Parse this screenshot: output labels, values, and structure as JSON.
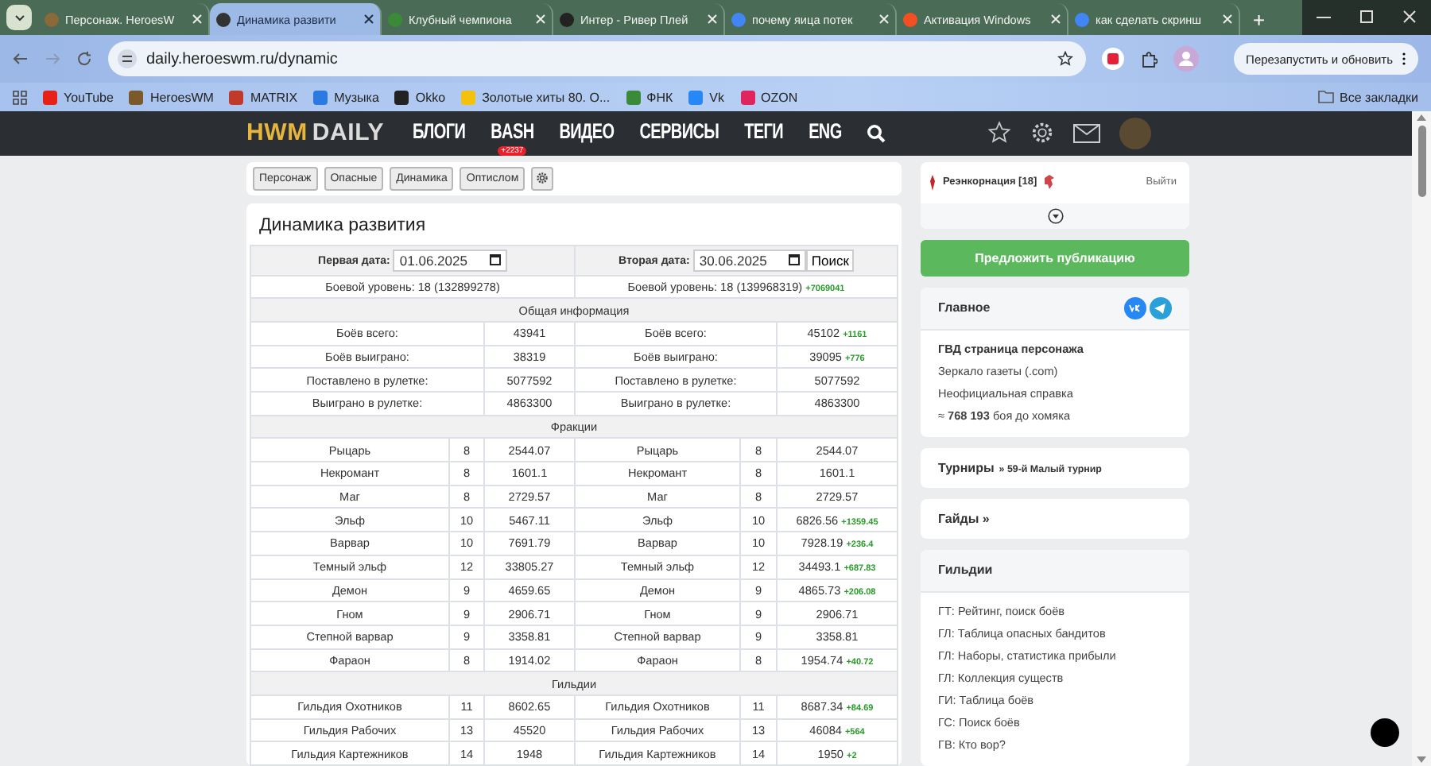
{
  "browser": {
    "tabs": [
      {
        "title": "Персонаж. HeroesW",
        "selected": false,
        "color": "#8a6a3a"
      },
      {
        "title": "Динамика развити",
        "selected": true,
        "color": "#333333"
      },
      {
        "title": "Клубный чемпиона",
        "selected": false,
        "color": "#3a8a3a"
      },
      {
        "title": "Интер - Ривер Плей",
        "selected": false,
        "color": "#222222"
      },
      {
        "title": "почему яица потек",
        "selected": false,
        "color": "#4285f4"
      },
      {
        "title": "Активация Windows",
        "selected": false,
        "color": "#f25022"
      },
      {
        "title": "как сделать скринш",
        "selected": false,
        "color": "#4285f4"
      }
    ],
    "new_tab": "+",
    "address": "daily.heroeswm.ru/dynamic",
    "restart_button": "Перезапустить и обновить",
    "bookmarks": [
      {
        "label": "YouTube",
        "color": "#e62117"
      },
      {
        "label": "HeroesWM",
        "color": "#7a5a2a"
      },
      {
        "label": "MATRIX",
        "color": "#c0392b"
      },
      {
        "label": "Музыка",
        "color": "#2a7ae2"
      },
      {
        "label": "Okko",
        "color": "#222222"
      },
      {
        "label": "Золотые хиты 80. О...",
        "color": "#f4c20d"
      },
      {
        "label": "ФНК",
        "color": "#3a8a3a"
      },
      {
        "label": "Vk",
        "color": "#2787f5"
      },
      {
        "label": "OZON",
        "color": "#e0245e"
      }
    ],
    "all_bookmarks": "Все закладки"
  },
  "site_nav": {
    "logo_first": "HWM",
    "logo_second": "DAILY",
    "menu": [
      {
        "label": "БЛОГИ"
      },
      {
        "label": "BASH",
        "badge": "+2237"
      },
      {
        "label": "ВИДЕО"
      },
      {
        "label": "СЕРВИСЫ"
      },
      {
        "label": "ТЕГИ"
      },
      {
        "label": "ENG"
      }
    ]
  },
  "subnav": [
    "Персонаж",
    "Опасные",
    "Динамика",
    "Оптислом"
  ],
  "dynamics": {
    "title": "Динамика развития",
    "first_date": {
      "label": "Первая дата:",
      "value": "01.06.2025"
    },
    "second_date": {
      "label": "Вторая дата:",
      "value": "30.06.2025"
    },
    "search_button": "Поиск",
    "level": {
      "left": "Боевой уровень: 18 (132899278)",
      "right": "Боевой уровень: 18 (139968319)",
      "right_delta": "+7069041"
    },
    "sections": [
      {
        "title": "Общая информация",
        "kind": "stats",
        "rows": [
          {
            "left_name": "Боёв всего:",
            "left_value": "43941",
            "right_name": "Боёв всего:",
            "right_value": "45102",
            "delta": "+1161"
          },
          {
            "left_name": "Боёв выиграно:",
            "left_value": "38319",
            "right_name": "Боёв выиграно:",
            "right_value": "39095",
            "delta": "+776"
          },
          {
            "left_name": "Поставлено в рулетке:",
            "left_value": "5077592",
            "right_name": "Поставлено в рулетке:",
            "right_value": "5077592"
          },
          {
            "left_name": "Выиграно в рулетке:",
            "left_value": "4863300",
            "right_name": "Выиграно в рулетке:",
            "right_value": "4863300"
          }
        ]
      },
      {
        "title": "Фракции",
        "kind": "levels",
        "rows": [
          {
            "left_name": "Рыцарь",
            "left_level": "8",
            "left_value": "2544.07",
            "right_name": "Рыцарь",
            "right_level": "8",
            "right_value": "2544.07"
          },
          {
            "left_name": "Некромант",
            "left_level": "8",
            "left_value": "1601.1",
            "right_name": "Некромант",
            "right_level": "8",
            "right_value": "1601.1"
          },
          {
            "left_name": "Маг",
            "left_level": "8",
            "left_value": "2729.57",
            "right_name": "Маг",
            "right_level": "8",
            "right_value": "2729.57"
          },
          {
            "left_name": "Эльф",
            "left_level": "10",
            "left_value": "5467.11",
            "right_name": "Эльф",
            "right_level": "10",
            "right_value": "6826.56",
            "delta": "+1359.45"
          },
          {
            "left_name": "Варвар",
            "left_level": "10",
            "left_value": "7691.79",
            "right_name": "Варвар",
            "right_level": "10",
            "right_value": "7928.19",
            "delta": "+236.4"
          },
          {
            "left_name": "Темный эльф",
            "left_level": "12",
            "left_value": "33805.27",
            "right_name": "Темный эльф",
            "right_level": "12",
            "right_value": "34493.1",
            "delta": "+687.83"
          },
          {
            "left_name": "Демон",
            "left_level": "9",
            "left_value": "4659.65",
            "right_name": "Демон",
            "right_level": "9",
            "right_value": "4865.73",
            "delta": "+206.08"
          },
          {
            "left_name": "Гном",
            "left_level": "9",
            "left_value": "2906.71",
            "right_name": "Гном",
            "right_level": "9",
            "right_value": "2906.71"
          },
          {
            "left_name": "Степной варвар",
            "left_level": "9",
            "left_value": "3358.81",
            "right_name": "Степной варвар",
            "right_level": "9",
            "right_value": "3358.81"
          },
          {
            "left_name": "Фараон",
            "left_level": "8",
            "left_value": "1914.02",
            "right_name": "Фараон",
            "right_level": "8",
            "right_value": "1954.74",
            "delta": "+40.72"
          }
        ]
      },
      {
        "title": "Гильдии",
        "kind": "levels",
        "rows": [
          {
            "left_name": "Гильдия Охотников",
            "left_level": "11",
            "left_value": "8602.65",
            "right_name": "Гильдия Охотников",
            "right_level": "11",
            "right_value": "8687.34",
            "delta": "+84.69"
          },
          {
            "left_name": "Гильдия Рабочих",
            "left_level": "13",
            "left_value": "45520",
            "right_name": "Гильдия Рабочих",
            "right_level": "13",
            "right_value": "46084",
            "delta": "+564"
          },
          {
            "left_name": "Гильдия Картежников",
            "left_level": "14",
            "left_value": "1948",
            "right_name": "Гильдия Картежников",
            "right_level": "14",
            "right_value": "1950",
            "delta": "+2"
          }
        ]
      }
    ]
  },
  "sidebar": {
    "user": {
      "name": "Реэнкорнация [18]",
      "logout": "Выйти"
    },
    "propose_button": "Предложить публикацию",
    "main": {
      "title": "Главное",
      "links": [
        {
          "text": "ГВД страница персонажа",
          "bold": true
        },
        {
          "text": "Зеркало газеты (.com)",
          "bold": false
        },
        {
          "text": "Неофициальная справка",
          "bold": false
        },
        {
          "text": "≈ **768 193** боя до хомяка",
          "bold": false
        }
      ]
    },
    "tournaments": {
      "title": "Турниры",
      "link": "» 59-й Малый турнир"
    },
    "guides": {
      "title": "Гайды »"
    },
    "guilds": {
      "title": "Гильдии",
      "links": [
        "ГТ: Рейтинг, поиск боёв",
        "ГЛ: Таблица опасных бандитов",
        "ГЛ: Наборы, статистика прибыли",
        "ГЛ: Коллекция существ",
        "ГИ: Таблица боёв",
        "ГС: Поиск боёв",
        "ГВ: Кто вор?"
      ]
    }
  }
}
